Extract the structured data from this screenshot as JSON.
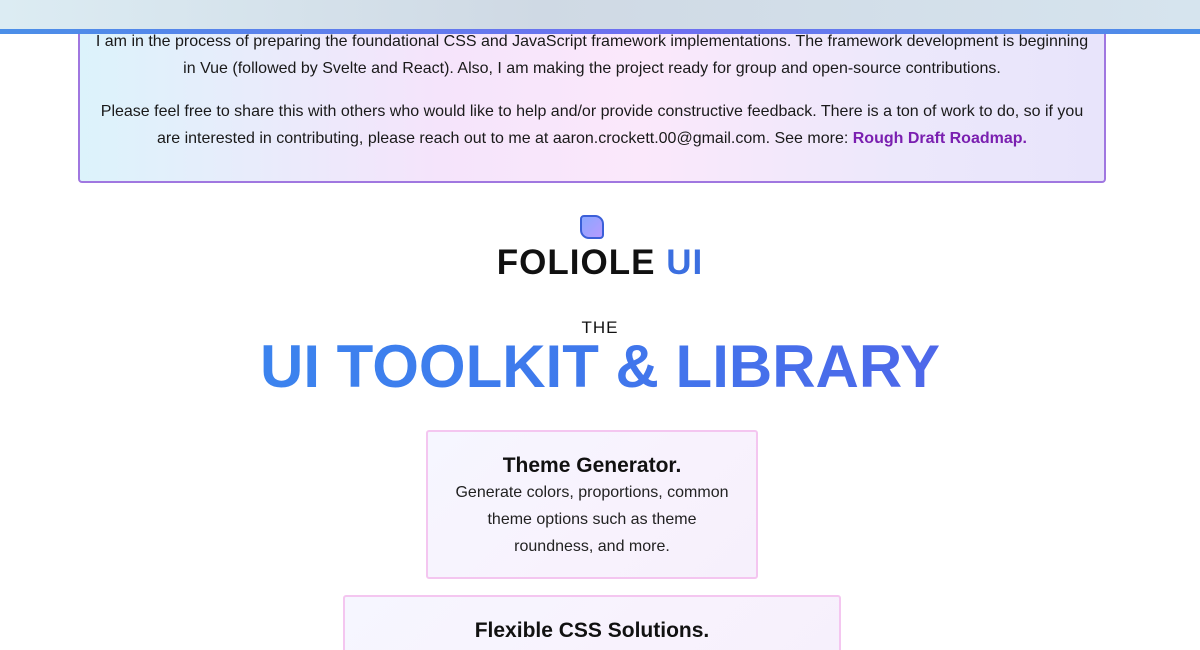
{
  "notice": {
    "line1": "I am in the process of preparing the foundational CSS and JavaScript framework implementations. The framework development is beginning in Vue (followed by Svelte and React). Also, I am making the project ready for group and open-source contributions.",
    "line2_prefix": "Please feel free to share this with others who would like to help and/or provide constructive feedback. There is a ton of work to do, so if you are interested in contributing, please reach out to me at aaron.crockett.00@gmail.com. See more: ",
    "link_label": "Rough Draft Roadmap."
  },
  "brand": {
    "name": "FOLIOLE",
    "accent": "UI",
    "icon": "leaf-logo-icon"
  },
  "hero": {
    "pre": "THE",
    "title": "UI TOOLKIT & LIBRARY"
  },
  "features": [
    {
      "title": "Theme Generator.",
      "description": "Generate colors, proportions, common theme options such as theme roundness, and more."
    },
    {
      "title": "Flexible CSS Solutions.",
      "description": ""
    }
  ],
  "colors": {
    "accent_blue": "#3b6fe0",
    "link_purple": "#7a1fb0",
    "notice_border": "#a077e0",
    "card_border": "#f4c6f0"
  }
}
